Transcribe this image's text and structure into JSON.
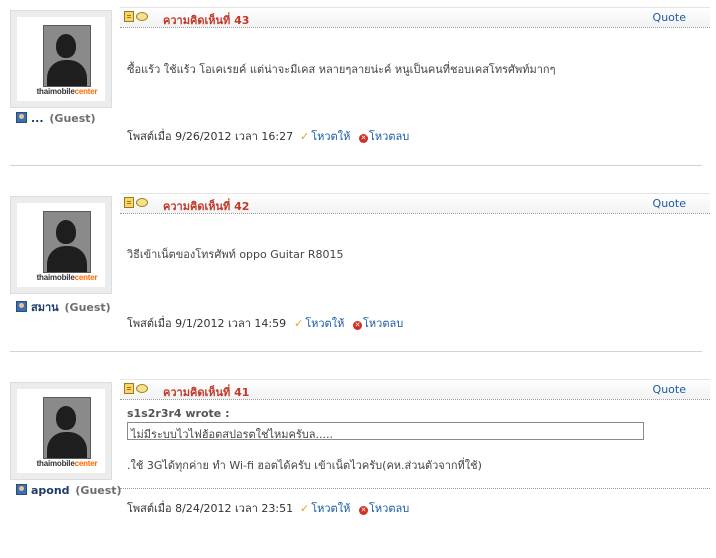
{
  "logo": {
    "text_main": "thaimobile",
    "text_accent": "center"
  },
  "quote_label": "Quote",
  "vote_up_label": "โหวตให้",
  "vote_down_label": "โหวตลบ",
  "guest_label": "(Guest)",
  "posts": [
    {
      "comment_label": "ความคิดเห็นที่ 43",
      "username": "...",
      "body": "ซื้อแร้ว ใช้แร้ว โอเคเรยค์ แต่น่าจะมีเคส หลายๆลายน่ะค์ หนูเป็นคนที่ชอบเคสโทรศัพท์มากๆ",
      "posted": "โพสต์เมื่อ 9/26/2012  เวลา 16:27"
    },
    {
      "comment_label": "ความคิดเห็นที่ 42",
      "username": "สมาน",
      "body": "วิธีเข้าเน็ตของโทรศัพท์ oppo Guitar R8015",
      "posted": "โพสต์เมื่อ 9/1/2012  เวลา 14:59"
    },
    {
      "comment_label": "ความคิดเห็นที่ 41",
      "username": "apond",
      "quote_author": "s1s2r3r4 wrote :",
      "quote_text": "ไม่มีระบบไวไฟฮ้อตสปอรตใช่ไหมครับล.....",
      "body": ".ใช้ 3Gได้ทุกค่าย ทำ Wi-fi ฮอตได้ครับ เข้าเน็ตไวครับ(คห.ส่วนตัวจากที่ใช้)",
      "posted": "โพสต์เมื่อ 8/24/2012  เวลา 23:51"
    }
  ]
}
